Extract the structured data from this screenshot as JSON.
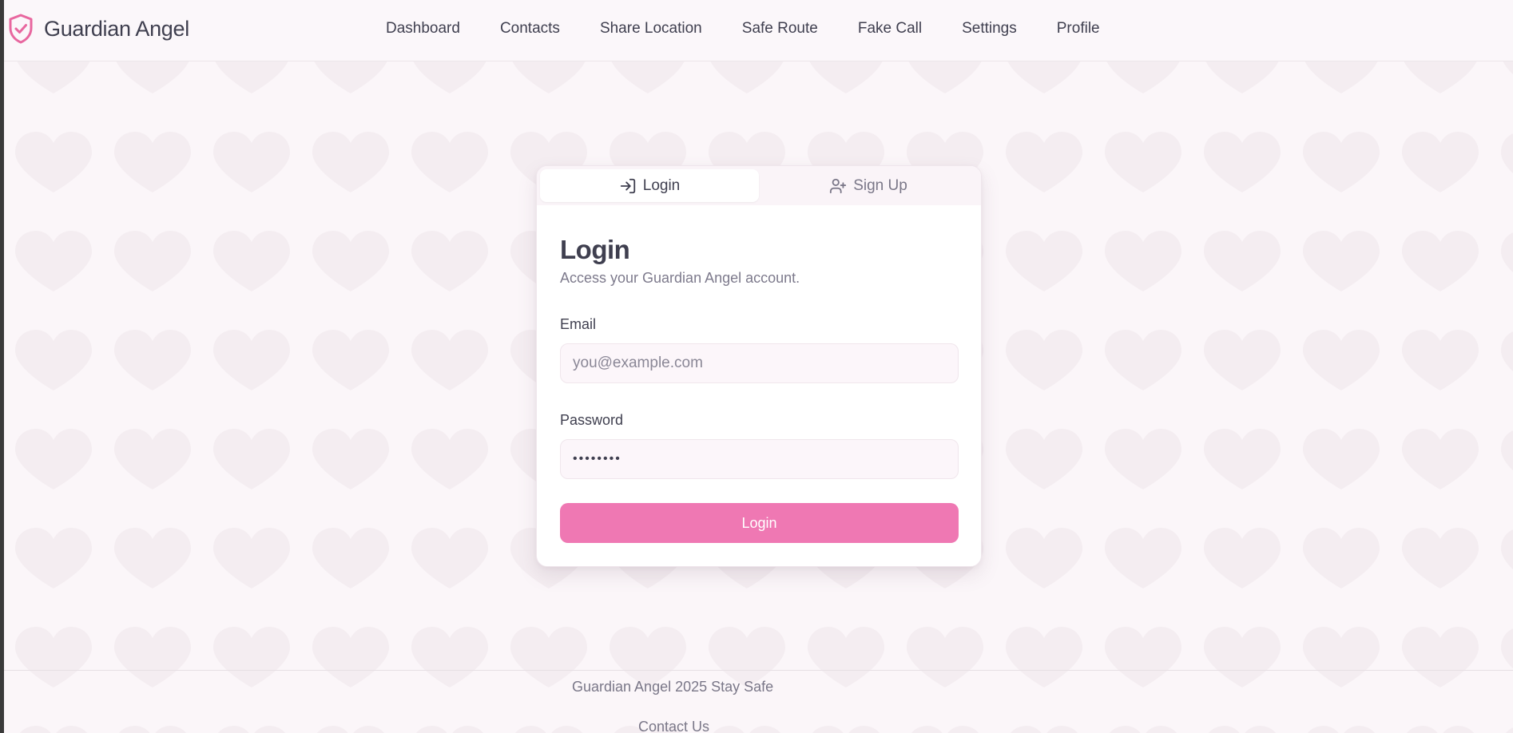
{
  "header": {
    "brand_name": "Guardian Angel",
    "brand_icon": "shield-check-icon",
    "nav": [
      {
        "label": "Dashboard"
      },
      {
        "label": "Contacts"
      },
      {
        "label": "Share Location"
      },
      {
        "label": "Safe Route"
      },
      {
        "label": "Fake Call"
      },
      {
        "label": "Settings"
      },
      {
        "label": "Profile"
      }
    ]
  },
  "auth_card": {
    "tabs": [
      {
        "label": "Login",
        "icon": "log-in-icon",
        "active": true
      },
      {
        "label": "Sign Up",
        "icon": "user-plus-icon",
        "active": false
      }
    ],
    "title": "Login",
    "subtitle": "Access your Guardian Angel account.",
    "email": {
      "label": "Email",
      "placeholder": "you@example.com",
      "value": ""
    },
    "password": {
      "label": "Password",
      "value": "••••••••"
    },
    "submit_label": "Login"
  },
  "footer": {
    "text": "Guardian Angel 2025 Stay Safe",
    "contact_link": "Contact Us"
  },
  "colors": {
    "accent": "#ef78b3",
    "brand_icon": "#e8679f",
    "background": "#fbf6f9",
    "text": "#3f3f4f",
    "muted_text": "#7a7788",
    "heart_pattern": "#f3ecf0"
  }
}
